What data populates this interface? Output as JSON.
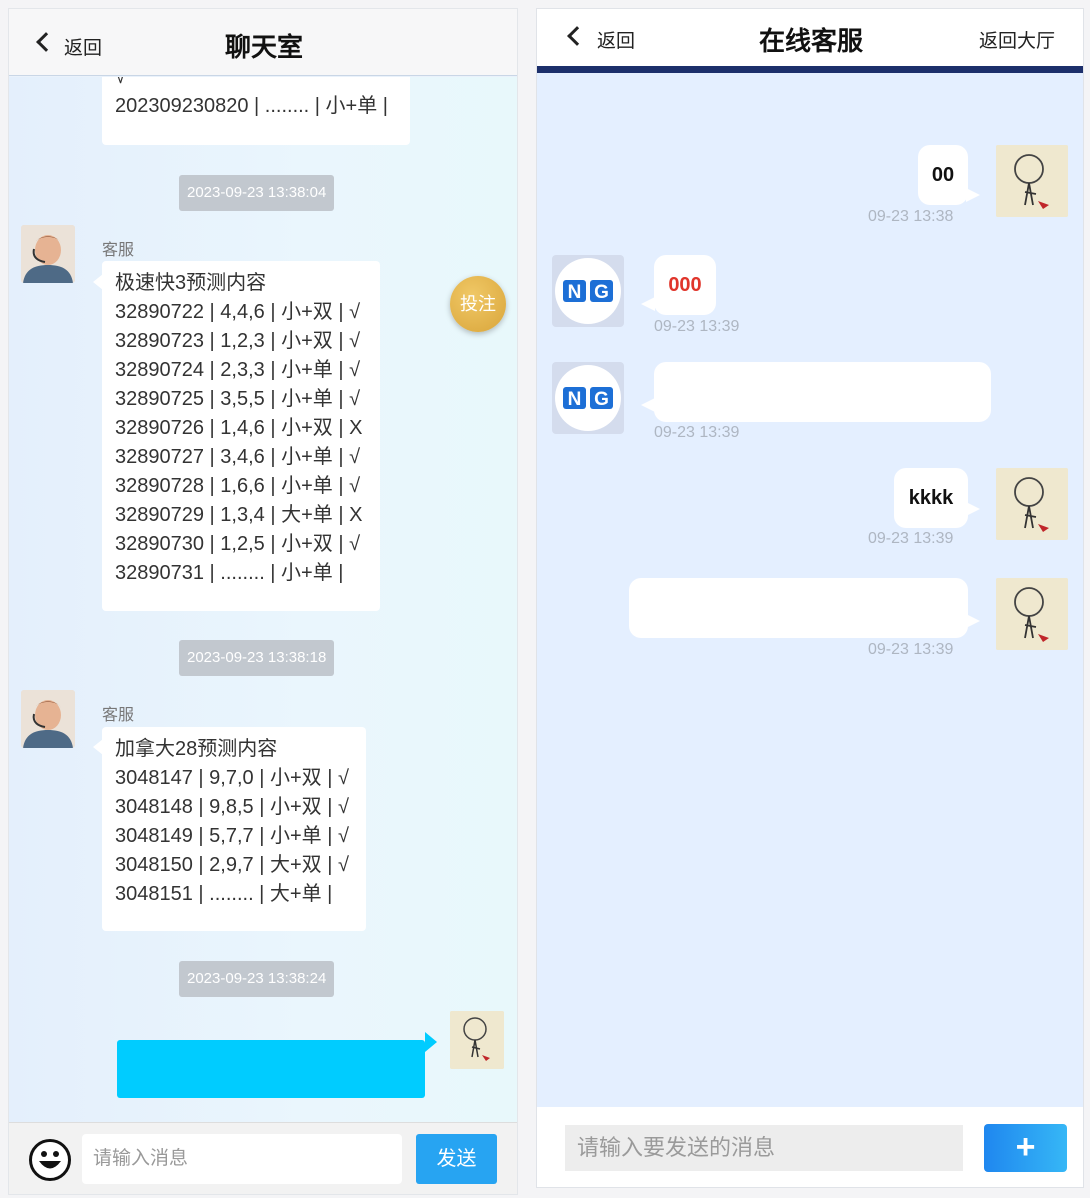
{
  "left_panel": {
    "header": {
      "back_label": "返回",
      "title": "聊天室"
    },
    "top_cut_message": {
      "lines": [
        "√",
        "202309230820 | ........ | 小+单 |"
      ]
    },
    "messages": [
      {
        "time": "2023-09-23 13:38:04",
        "sender": "客服",
        "lines": [
          "极速快3预测内容",
          "32890722 | 4,4,6 | 小+双 | √",
          "32890723 | 1,2,3 | 小+双 | √",
          "32890724 | 2,3,3 | 小+单 | √",
          "32890725 | 3,5,5 | 小+单 | √",
          "32890726 | 1,4,6 | 小+双 | X",
          "32890727 | 3,4,6 | 小+单 | √",
          "32890728 | 1,6,6 | 小+单 | √",
          "32890729 | 1,3,4 | 大+单 | X",
          "32890730 | 1,2,5 | 小+双 | √",
          "32890731 | ........ | 小+单 |"
        ]
      },
      {
        "time": "2023-09-23 13:38:18",
        "sender": "客服",
        "lines": [
          "加拿大28预测内容",
          "3048147 | 9,7,0 | 小+双 | √",
          "3048148 | 9,8,5 | 小+双 | √",
          "3048149 | 5,7,7 | 小+单 | √",
          "3048150 | 2,9,7 | 大+双 | √",
          "3048151 | ........ | 大+单 |"
        ]
      }
    ],
    "my_message": {
      "time": "2023-09-23 13:38:24",
      "bubble_color": "#00ccff"
    },
    "bet_button": "投注",
    "input_placeholder": "请输入消息",
    "send_label": "发送"
  },
  "right_panel": {
    "header": {
      "back_label": "返回",
      "title": "在线客服",
      "lobby_label": "返回大厅"
    },
    "messages": [
      {
        "side": "right",
        "text": "00",
        "time": "09-23 13:38"
      },
      {
        "side": "left",
        "text": "000",
        "time": "09-23 13:39",
        "text_color": "#e0352b"
      },
      {
        "side": "left",
        "text": "",
        "time": "09-23 13:39"
      },
      {
        "side": "right",
        "text": "kkkk",
        "time": "09-23 13:39"
      },
      {
        "side": "right",
        "text": "",
        "time": "09-23 13:39"
      }
    ],
    "agent_avatar_text": "NG",
    "input_placeholder": "请输入要发送的消息",
    "plus_label": "+"
  },
  "colors": {
    "accent_blue": "#27a4f2",
    "nav_dark": "#1c2f6b",
    "bet_gold": "#e0b34c",
    "ng_blue": "#1d6fd6"
  }
}
